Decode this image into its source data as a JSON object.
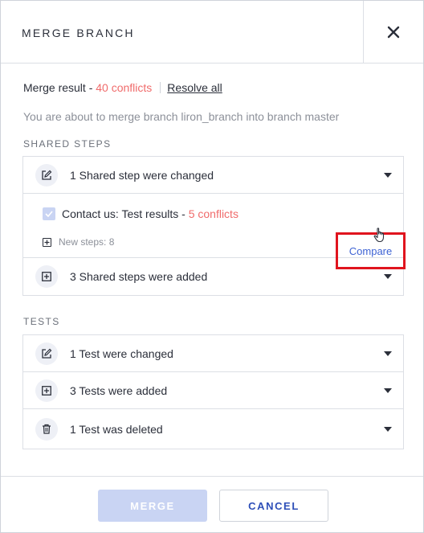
{
  "dialog": {
    "title": "MERGE BRANCH",
    "close_icon": "close-icon"
  },
  "merge_result": {
    "label": "Merge result - ",
    "conflicts": "40 conflicts",
    "resolve_all": "Resolve all"
  },
  "about_text": "You are about to merge branch liron_branch  into branch master",
  "shared_steps": {
    "section_label": "SHARED STEPS",
    "changed": {
      "icon": "edit-icon",
      "label": "1 Shared step were changed"
    },
    "conflict_item": {
      "checked": true,
      "label": "Contact us: Test results - ",
      "conflicts": "5 conflicts",
      "compare": "Compare",
      "new_steps": "New steps: 8"
    },
    "added": {
      "icon": "plus-square-icon",
      "label": "3 Shared steps were added"
    }
  },
  "tests": {
    "section_label": "TESTS",
    "rows": [
      {
        "icon": "edit-icon",
        "label": "1 Test were changed"
      },
      {
        "icon": "plus-square-icon",
        "label": "3 Tests were added"
      },
      {
        "icon": "trash-icon",
        "label": "1 Test was deleted"
      }
    ]
  },
  "footer": {
    "merge_label": "MERGE",
    "cancel_label": "CANCEL"
  },
  "colors": {
    "conflict_red": "#f06b6b",
    "link_blue": "#3e63d4",
    "highlight_box": "#e0141e",
    "disabled_merge": "#c9d4f3"
  }
}
